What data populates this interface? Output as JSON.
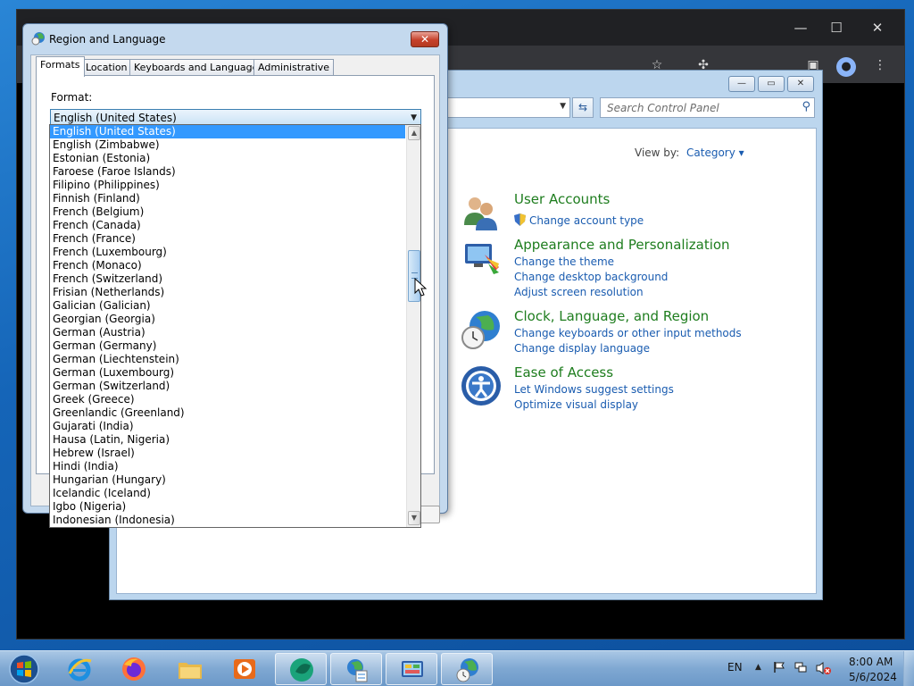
{
  "control_panel": {
    "search_placeholder": "Search Control Panel",
    "view_by_label": "View by:",
    "view_by_value": "Category ▾",
    "categories": [
      {
        "title": "User Accounts",
        "links": [
          "Change account type"
        ]
      },
      {
        "title": "Appearance and Personalization",
        "links": [
          "Change the theme",
          "Change desktop background",
          "Adjust screen resolution"
        ]
      },
      {
        "title": "Clock, Language, and Region",
        "links": [
          "Change keyboards or other input methods",
          "Change display language"
        ]
      },
      {
        "title": "Ease of Access",
        "links": [
          "Let Windows suggest settings",
          "Optimize visual display"
        ]
      }
    ]
  },
  "dialog": {
    "title": "Region and Language",
    "tabs": [
      "Formats",
      "Location",
      "Keyboards and Languages",
      "Administrative"
    ],
    "active_tab": "Formats",
    "format_label": "Format:",
    "format_value": "English (United States)",
    "dropdown_items": [
      "English (United States)",
      "English (Zimbabwe)",
      "Estonian (Estonia)",
      "Faroese (Faroe Islands)",
      "Filipino (Philippines)",
      "Finnish (Finland)",
      "French (Belgium)",
      "French (Canada)",
      "French (France)",
      "French (Luxembourg)",
      "French (Monaco)",
      "French (Switzerland)",
      "Frisian (Netherlands)",
      "Galician (Galician)",
      "Georgian (Georgia)",
      "German (Austria)",
      "German (Germany)",
      "German (Liechtenstein)",
      "German (Luxembourg)",
      "German (Switzerland)",
      "Greek (Greece)",
      "Greenlandic (Greenland)",
      "Gujarati (India)",
      "Hausa (Latin, Nigeria)",
      "Hebrew (Israel)",
      "Hindi (India)",
      "Hungarian (Hungary)",
      "Icelandic (Iceland)",
      "Igbo (Nigeria)",
      "Indonesian (Indonesia)"
    ],
    "selected_index": 0
  },
  "taskbar": {
    "language": "EN",
    "time": "8:00 AM",
    "date": "5/6/2024"
  }
}
